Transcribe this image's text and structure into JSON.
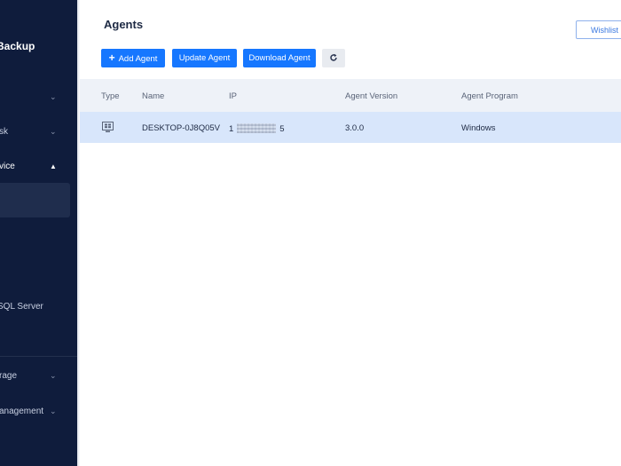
{
  "sidebar": {
    "brand": "Backup",
    "items": [
      {
        "label": "",
        "chevron": "chevron-down"
      },
      {
        "label": "sk",
        "chevron": "chevron-down"
      },
      {
        "label": "vice",
        "chevron": "chevron-up"
      },
      {
        "label": "SQL Server"
      },
      {
        "label": "rage",
        "chevron": "chevron-down"
      },
      {
        "label": "anagement",
        "chevron": "chevron-down"
      }
    ]
  },
  "header": {
    "title": "Agents",
    "wishlist_label": "Wishlist"
  },
  "toolbar": {
    "add_label": "Add Agent",
    "update_label": "Update Agent",
    "download_label": "Download Agent",
    "refresh_icon": "refresh-icon"
  },
  "table": {
    "columns": [
      "Type",
      "Name",
      "IP",
      "Agent Version",
      "Agent Program"
    ],
    "rows": [
      {
        "type_icon": "windows-monitor-icon",
        "name": "DESKTOP-0J8Q05V",
        "ip_start": "1",
        "ip_end": "5",
        "version": "3.0.0",
        "program": "Windows"
      }
    ]
  },
  "colors": {
    "sidebar_bg": "#0f1c3c",
    "accent": "#1677ff",
    "selected_row": "#d8e6fb"
  }
}
